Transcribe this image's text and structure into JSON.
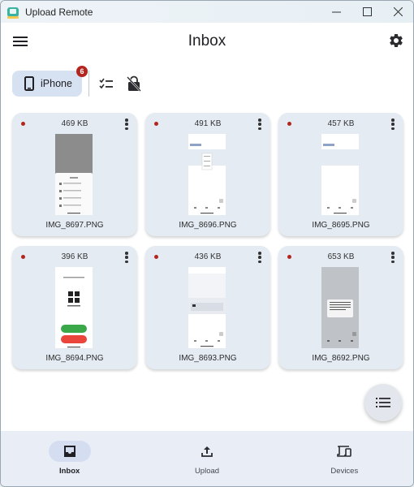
{
  "window": {
    "title": "Upload Remote",
    "controls": [
      "minimize",
      "maximize",
      "close"
    ]
  },
  "appbar": {
    "title": "Inbox",
    "menu_icon": "hamburger-menu-icon",
    "settings_icon": "gear-icon"
  },
  "filter": {
    "device_chip": {
      "label": "iPhone",
      "icon": "smartphone-icon",
      "badge": "6",
      "selected": true
    },
    "actions": [
      {
        "name": "select-all",
        "icon": "checklist-icon"
      },
      {
        "name": "lock-off",
        "icon": "lock-off-icon"
      }
    ]
  },
  "files": [
    {
      "size": "469 KB",
      "name": "IMG_8697.PNG",
      "unread": true,
      "preview": "dark-sheet"
    },
    {
      "size": "491 KB",
      "name": "IMG_8696.PNG",
      "unread": true,
      "preview": "light-menu"
    },
    {
      "size": "457 KB",
      "name": "IMG_8695.PNG",
      "unread": true,
      "preview": "light"
    },
    {
      "size": "396 KB",
      "name": "IMG_8694.PNG",
      "unread": true,
      "preview": "qr-buttons"
    },
    {
      "size": "436 KB",
      "name": "IMG_8693.PNG",
      "unread": true,
      "preview": "light-card"
    },
    {
      "size": "653 KB",
      "name": "IMG_8692.PNG",
      "unread": true,
      "preview": "dialog"
    }
  ],
  "fab": {
    "icon": "list-icon"
  },
  "nav": {
    "items": [
      {
        "label": "Inbox",
        "icon": "inbox-icon",
        "active": true
      },
      {
        "label": "Upload",
        "icon": "upload-icon",
        "active": false
      },
      {
        "label": "Devices",
        "icon": "devices-icon",
        "active": false
      }
    ]
  },
  "colors": {
    "accent_chip": "#d6e2f1",
    "badge": "#b3261e",
    "card": "#e4ebf3",
    "navbar": "#e9eef6"
  }
}
